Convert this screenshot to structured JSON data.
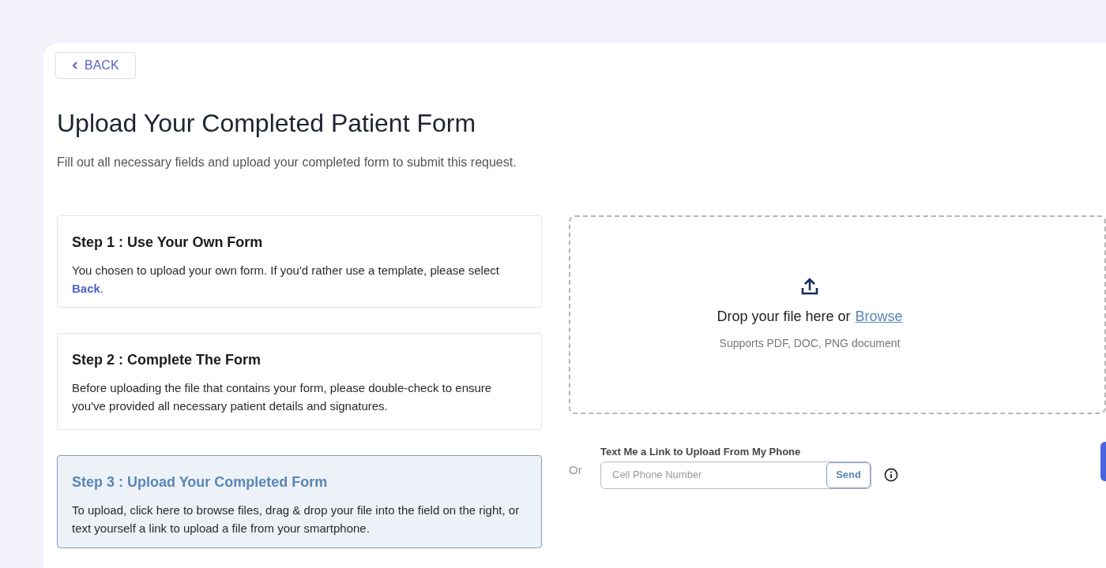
{
  "back_button": {
    "label": "BACK"
  },
  "title": "Upload Your Completed Patient Form",
  "subtitle": "Fill out all necessary fields and upload your completed form to submit this request.",
  "steps": [
    {
      "title": "Step 1 : Use Your Own Form",
      "text": "You chosen to upload your own form. If you'd rather use a template, please select ",
      "link": "Back",
      "text_after": ".",
      "selected": false
    },
    {
      "title": "Step 2 : Complete The Form",
      "text": "Before uploading the file that contains your form, please double-check to ensure you've provided all necessary patient details and signatures.",
      "selected": false
    },
    {
      "title": "Step 3 : Upload Your Completed Form",
      "text": "To upload, click here to browse files, drag & drop your file into the field on the right, or text yourself a link to upload a file from your smartphone.",
      "selected": true
    }
  ],
  "dropzone": {
    "prompt": "Drop your file here or",
    "link": "Browse",
    "hint": "Supports PDF, DOC, PNG document"
  },
  "or_label": "Or",
  "sms": {
    "label": "Text Me a Link to Upload From My Phone",
    "placeholder": "Cell Phone Number",
    "button": "Send"
  }
}
